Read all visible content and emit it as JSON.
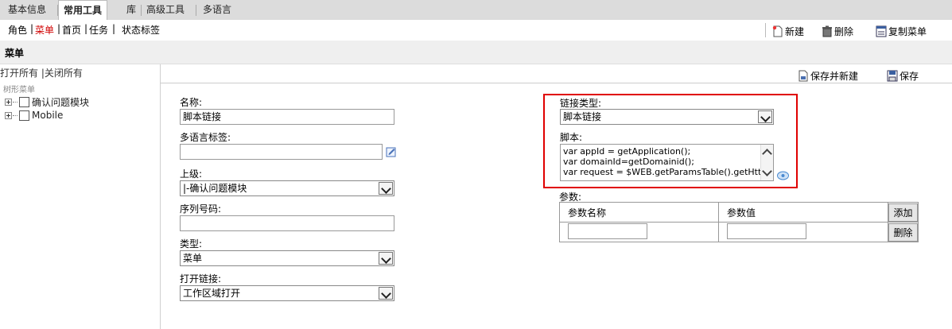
{
  "tabs": [
    {
      "label": "基本信息",
      "active": false
    },
    {
      "label": "常用工具",
      "active": true
    },
    {
      "label": "库",
      "active": false
    },
    {
      "label": "高级工具",
      "active": false
    },
    {
      "label": "多语言",
      "active": false
    }
  ],
  "subnav": [
    {
      "label": "角色",
      "active": false
    },
    {
      "label": "菜单",
      "active": true
    },
    {
      "label": "首页",
      "active": false
    },
    {
      "label": "任务",
      "active": false
    },
    {
      "label": "状态标签",
      "active": false
    }
  ],
  "toolbar": {
    "new_label": "新建",
    "delete_label": "删除",
    "copy_label": "复制菜单"
  },
  "page_title": "菜单",
  "tree": {
    "open_all": "打开所有",
    "close_all": "关闭所有",
    "caption": "树形菜单",
    "nodes": [
      "确认问题模块",
      "Mobile"
    ]
  },
  "actions": {
    "save_new_label": "保存并新建",
    "save_label": "保存"
  },
  "form": {
    "name_label": "名称:",
    "name_value": "脚本链接",
    "ml_label": "多语言标签:",
    "ml_value": "",
    "parent_label": "上级:",
    "parent_value": "|-确认问题模块",
    "seq_label": "序列号码:",
    "seq_value": "",
    "type_label": "类型:",
    "type_value": "菜单",
    "open_label": "打开链接:",
    "open_value": "工作区域打开",
    "link_type_label": "链接类型:",
    "link_type_value": "脚本链接",
    "script_label": "脚本:",
    "script_lines": [
      "var appId = getApplication();",
      "var domainId=getDomainid();",
      "var request = $WEB.getParamsTable().getHtt"
    ],
    "params_label": "参数:",
    "params_headers": [
      "参数名称",
      "参数值"
    ],
    "add_label": "添加",
    "del_label": "删除"
  },
  "colors": {
    "highlight": "#e00000",
    "active_subnav": "#d00000",
    "tab_bar": "#dcdcdc"
  }
}
